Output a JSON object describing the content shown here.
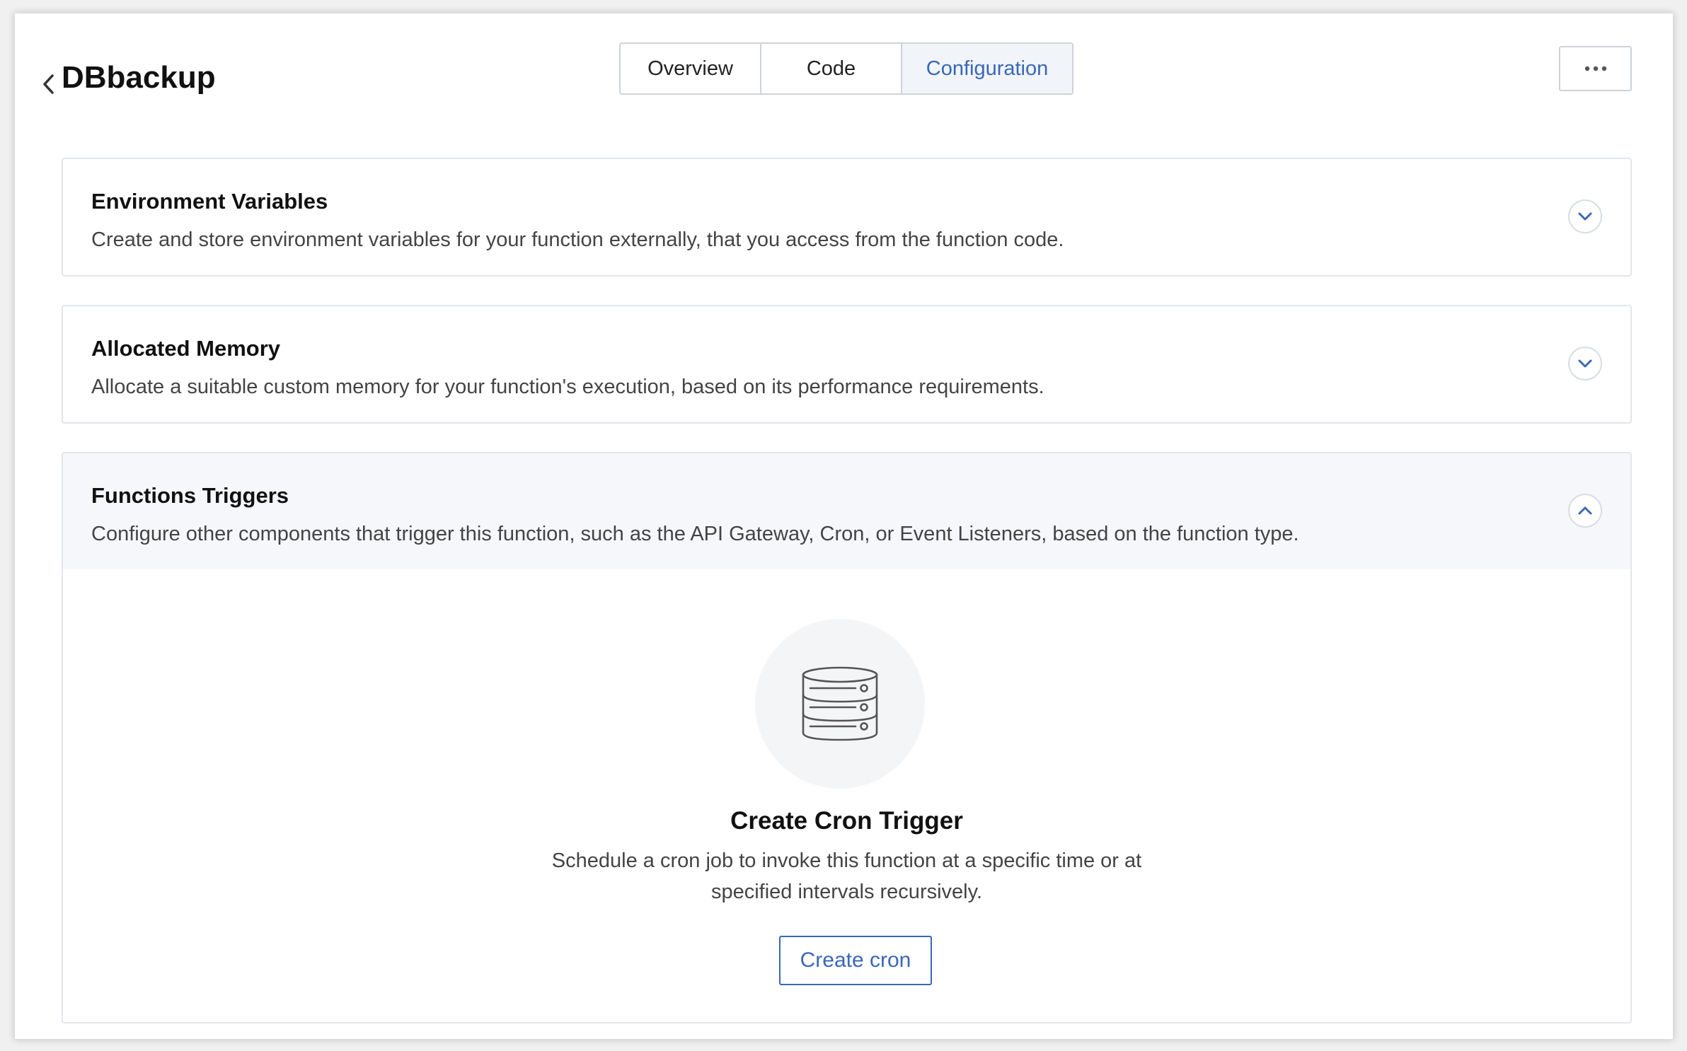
{
  "header": {
    "title": "DBbackup",
    "back_icon": "chevron-left-icon",
    "more_icon": "more-horizontal-icon"
  },
  "tabs": [
    {
      "label": "Overview",
      "active": false
    },
    {
      "label": "Code",
      "active": false
    },
    {
      "label": "Configuration",
      "active": true
    }
  ],
  "sections": {
    "env": {
      "title": "Environment Variables",
      "description": "Create and store environment variables for your function externally, that you access from the function code.",
      "expanded": false
    },
    "memory": {
      "title": "Allocated Memory",
      "description": "Allocate a suitable custom memory for your function's execution, based on its performance requirements.",
      "expanded": false
    },
    "triggers": {
      "title": "Functions Triggers",
      "description": "Configure other components that trigger this function, such as the API Gateway, Cron, or Event Listeners, based on the function type.",
      "expanded": true,
      "empty_state": {
        "icon": "server-database-icon",
        "title": "Create Cron Trigger",
        "description_line1": "Schedule a cron job to invoke this function at a specific time or at",
        "description_line2": "specified intervals recursively.",
        "button_label": "Create cron"
      }
    }
  },
  "colors": {
    "accent": "#3a67b8",
    "active_tab_bg": "#f1f4f8",
    "expanded_header_bg": "#f5f7fa"
  }
}
